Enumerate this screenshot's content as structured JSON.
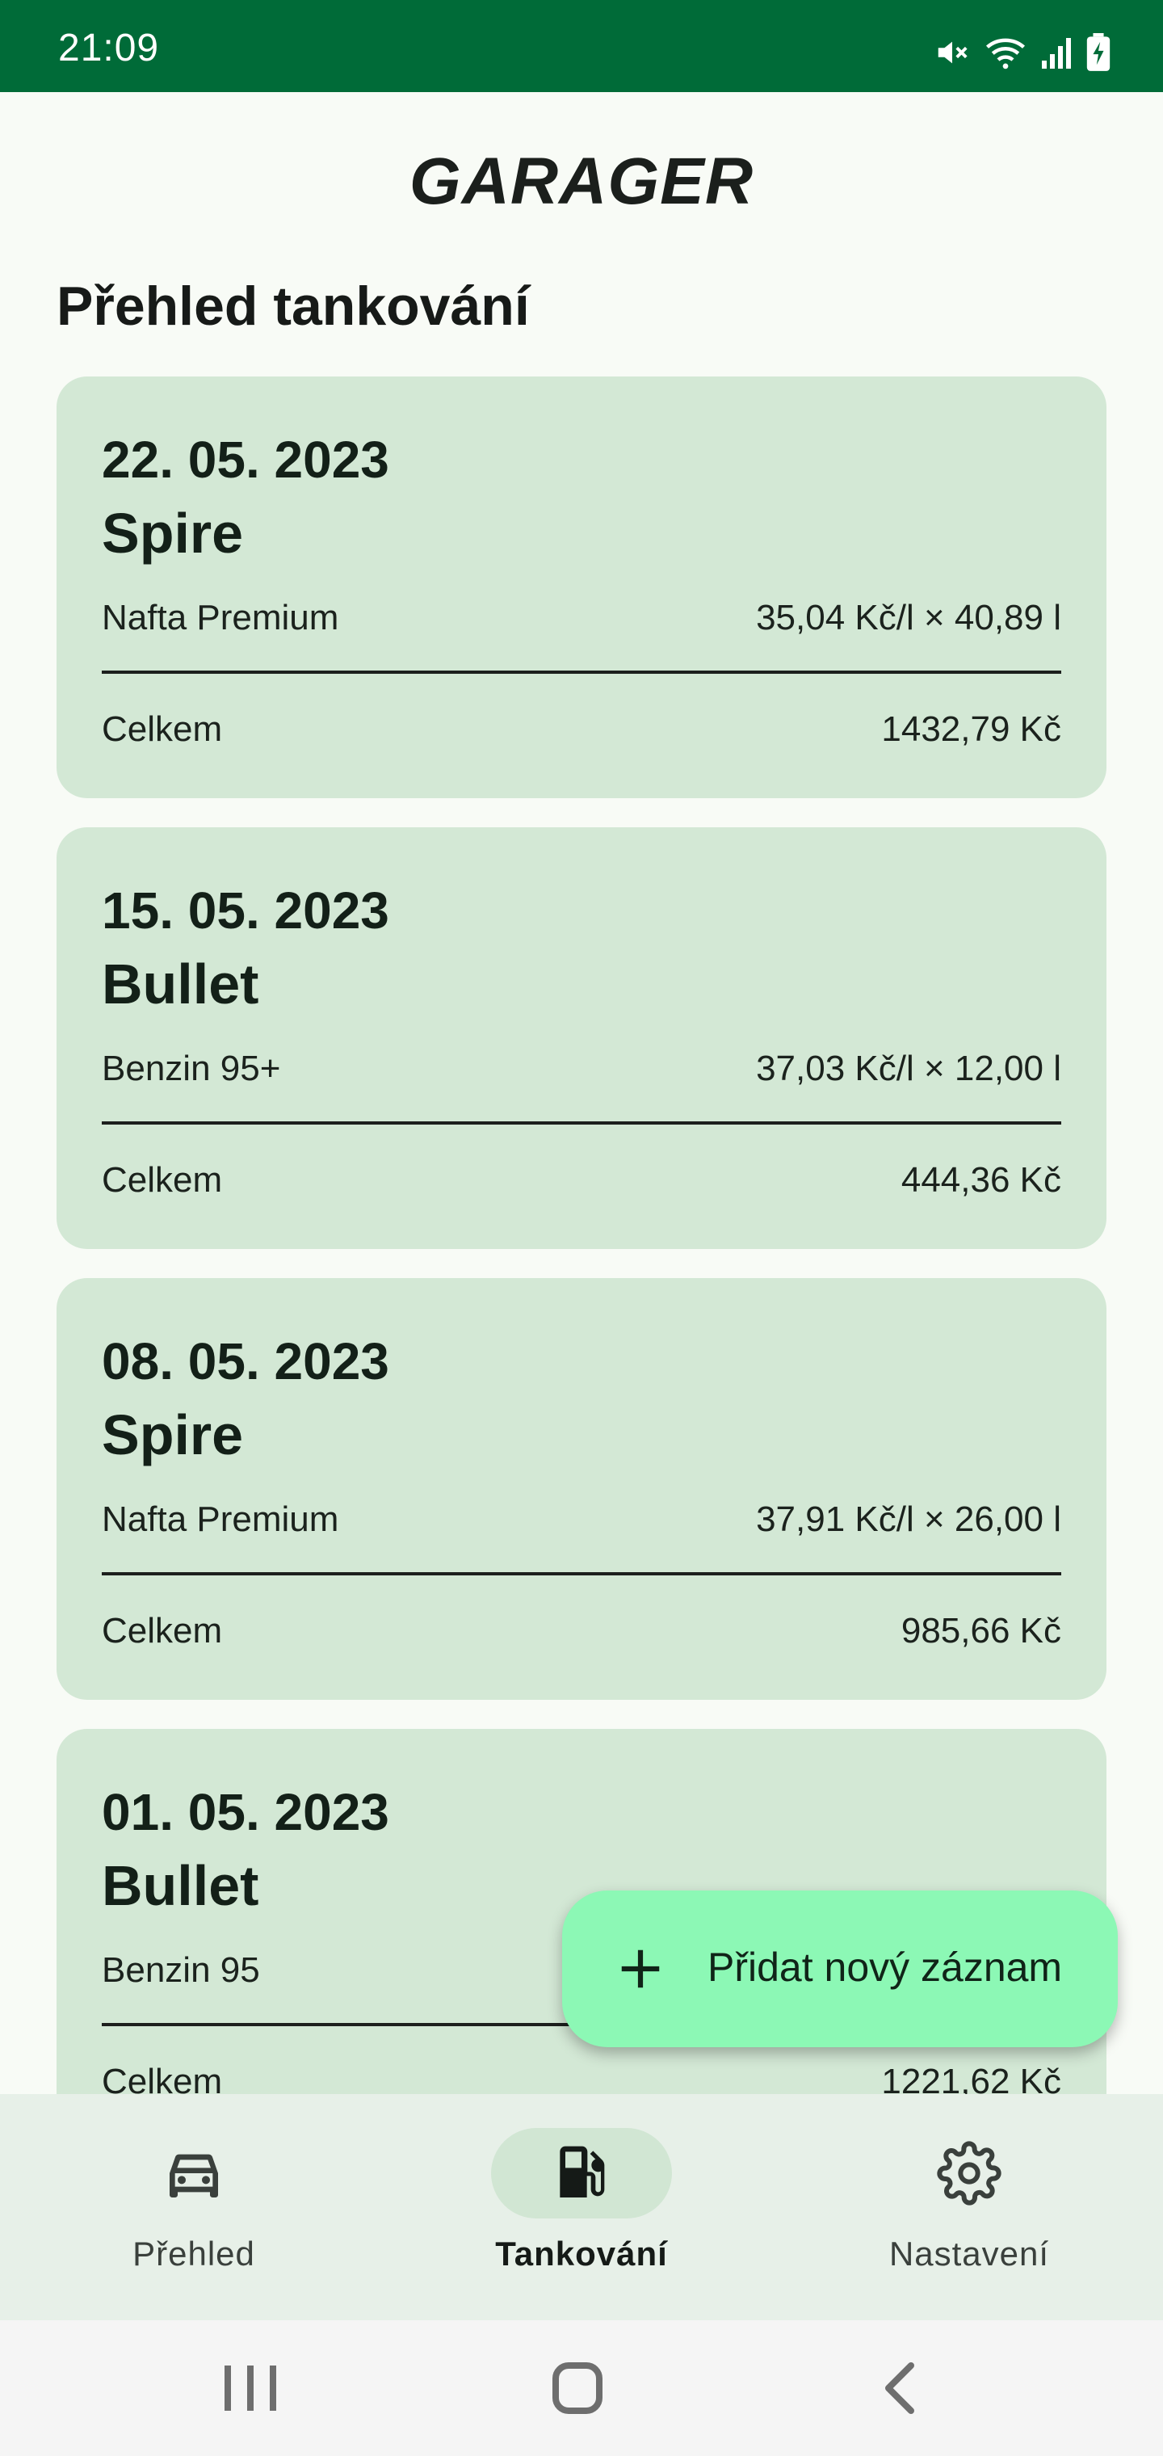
{
  "status_bar": {
    "time": "21:09",
    "icons": [
      "mute-icon",
      "wifi-icon",
      "signal-icon",
      "battery-charging-icon"
    ],
    "background": "#006b38"
  },
  "app": {
    "title": "GARAGER",
    "section_title": "Přehled tankování"
  },
  "entries": [
    {
      "date": "22. 05. 2023",
      "vehicle": "Spire",
      "fuel": "Nafta Premium",
      "calc": "35,04 Kč/l × 40,89 l",
      "total_label": "Celkem",
      "total": "1432,79 Kč"
    },
    {
      "date": "15. 05. 2023",
      "vehicle": "Bullet",
      "fuel": "Benzin 95+",
      "calc": "37,03 Kč/l × 12,00 l",
      "total_label": "Celkem",
      "total": "444,36 Kč"
    },
    {
      "date": "08. 05. 2023",
      "vehicle": "Spire",
      "fuel": "Nafta Premium",
      "calc": "37,91 Kč/l × 26,00 l",
      "total_label": "Celkem",
      "total": "985,66 Kč"
    },
    {
      "date": "01. 05. 2023",
      "vehicle": "Bullet",
      "fuel": "Benzin 95",
      "calc": "",
      "total_label": "Celkem",
      "total": "1221,62 Kč"
    }
  ],
  "fab": {
    "label": "Přidat nový záznam",
    "icon": "plus-icon",
    "color": "#8cf8b5"
  },
  "bottom_nav": {
    "items": [
      {
        "label": "Přehled",
        "icon": "car-icon",
        "active": false
      },
      {
        "label": "Tankování",
        "icon": "fuel-pump-icon",
        "active": true
      },
      {
        "label": "Nastavení",
        "icon": "gear-icon",
        "active": false
      }
    ]
  },
  "system_nav": {
    "buttons": [
      "recent-apps-icon",
      "home-icon",
      "back-icon"
    ]
  },
  "colors": {
    "card_background": "#d3e8d5",
    "page_background": "#f8fbf6",
    "nav_background": "#e7f0e8"
  }
}
